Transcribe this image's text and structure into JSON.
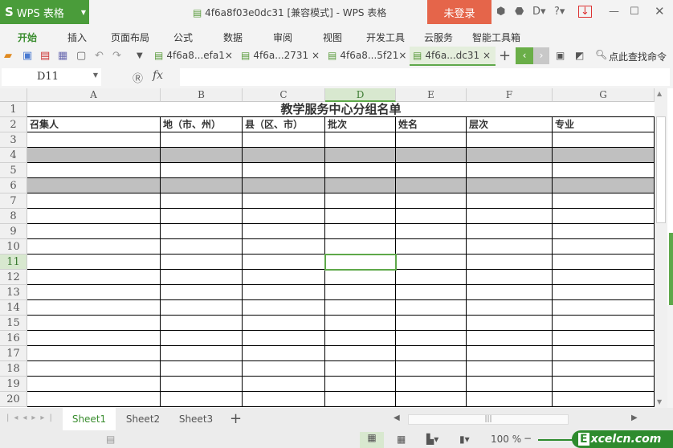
{
  "app": {
    "logo_text": "WPS 表格",
    "document_title": "4f6a8f03e0dc31 [兼容模式] - WPS 表格",
    "login_label": "未登录"
  },
  "menu": [
    "开始",
    "插入",
    "页面布局",
    "公式",
    "数据",
    "审阅",
    "视图",
    "开发工具",
    "云服务",
    "智能工具箱"
  ],
  "doc_tabs": [
    "4f6a8...efa1",
    "4f6a...2731",
    "4f6a8...5f21",
    "4f6a...dc31"
  ],
  "search_label": "点此查找命令",
  "formula_bar": {
    "name_box": "D11",
    "fx_label": "fx",
    "value": ""
  },
  "columns": [
    "A",
    "B",
    "C",
    "D",
    "E",
    "F",
    "G"
  ],
  "rows": [
    "1",
    "2",
    "3",
    "4",
    "5",
    "6",
    "7",
    "8",
    "9",
    "10",
    "11",
    "12",
    "13",
    "14",
    "15",
    "16",
    "17",
    "18",
    "19",
    "20"
  ],
  "sheet_title": "教学服务中心分组名单",
  "headers": [
    "召集人",
    "地（市、州）",
    "县（区、市）",
    "批次",
    "姓名",
    "层次",
    "专业"
  ],
  "gray_rows": [
    4,
    6
  ],
  "selected_cell": "D11",
  "sheets": [
    "Sheet1",
    "Sheet2",
    "Sheet3"
  ],
  "active_sheet": "Sheet1",
  "status": {
    "zoom": "100 %"
  },
  "watermark": "Excelcn.com",
  "accent_color": "#5ea84a"
}
